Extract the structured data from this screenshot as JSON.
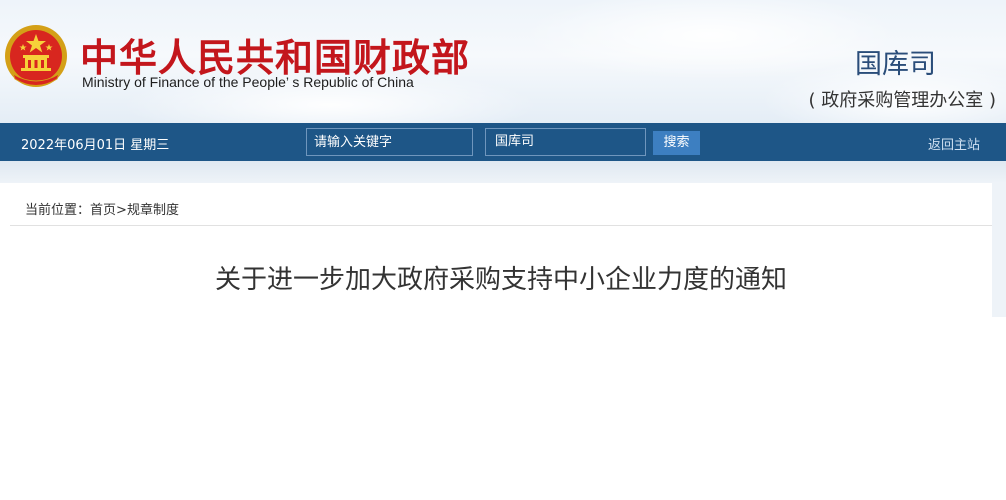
{
  "header": {
    "title_cn": "中华人民共和国财政部",
    "title_en": "Ministry of Finance of the People’ s Republic of China",
    "dept_name": "国库司",
    "dept_sub": "( 政府采购管理办公室 )"
  },
  "navbar": {
    "date": "2022年06月01日  星期三",
    "search_placeholder": "请输入关键字",
    "scope_value": "国库司",
    "search_label": "搜索",
    "home_label": "返回主站"
  },
  "breadcrumb": {
    "prefix": "当前位置：",
    "items": [
      "首页",
      "规章制度"
    ],
    "separator": ">"
  },
  "article": {
    "title": "关于进一步加大政府采购支持中小企业力度的通知"
  },
  "colors": {
    "brand_red": "#c3161c",
    "nav_blue": "#1e5687",
    "button_blue": "#3d7fc1"
  },
  "icons": {
    "emblem": "national-emblem-icon"
  }
}
